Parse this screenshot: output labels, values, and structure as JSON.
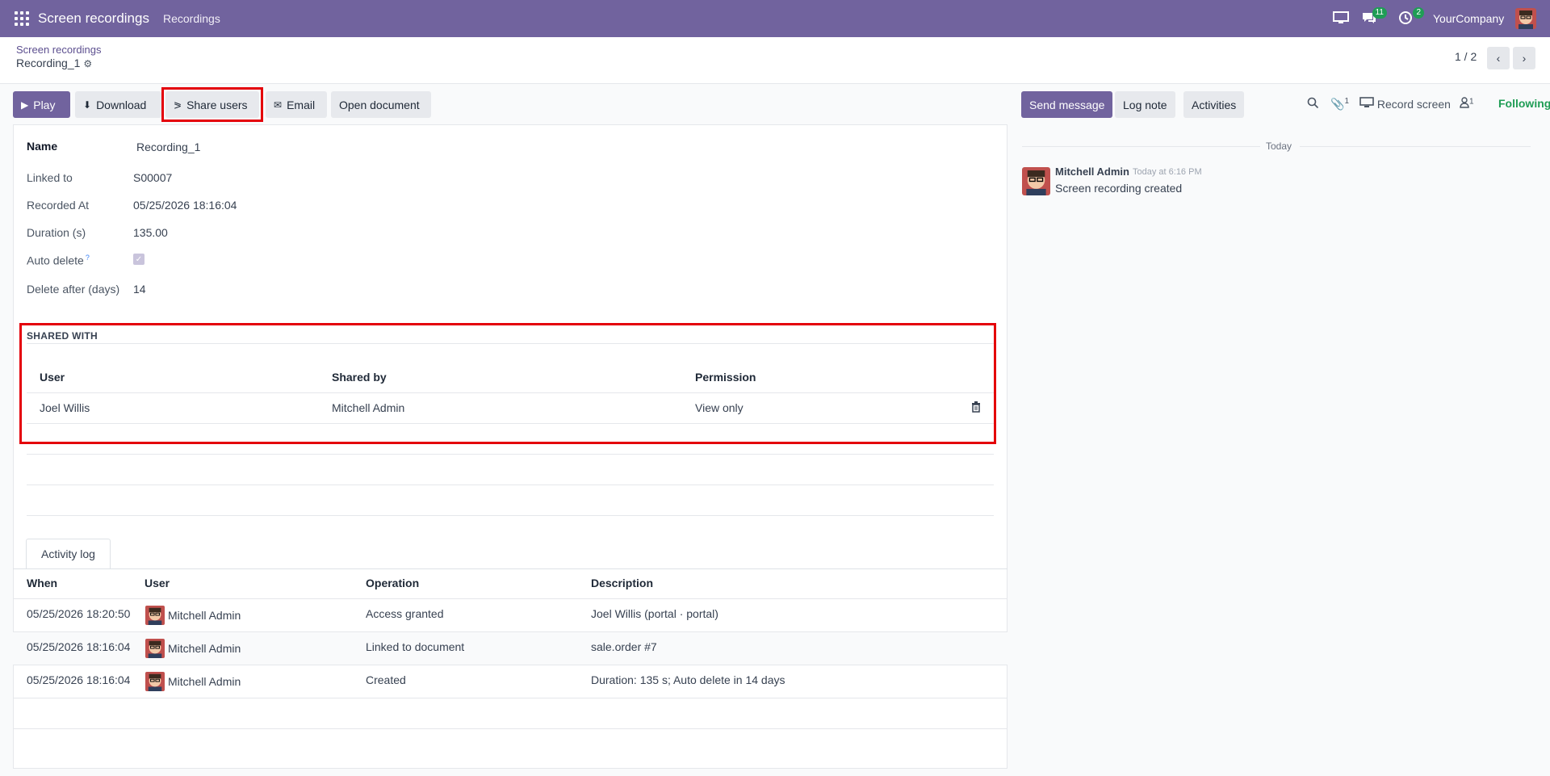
{
  "navbar": {
    "brand": "Screen recordings",
    "menu": "Recordings",
    "messages_badge": "11",
    "activities_badge": "2",
    "company": "YourCompany"
  },
  "breadcrumb": {
    "parent": "Screen recordings",
    "current": "Recording_1"
  },
  "pager": {
    "value": "1 / 2"
  },
  "actions": {
    "play": "Play",
    "download": "Download",
    "share_users": "Share users",
    "email": "Email",
    "open_document": "Open document"
  },
  "form": {
    "name_label": "Name",
    "name_value": "Recording_1",
    "linked_label": "Linked to",
    "linked_value": "S00007",
    "recorded_label": "Recorded At",
    "recorded_value": "05/25/2026 18:16:04",
    "duration_label": "Duration (s)",
    "duration_value": "135.00",
    "autodelete_label": "Auto delete",
    "autodelete_help": "?",
    "delete_after_label": "Delete after (days)",
    "delete_after_value": "14"
  },
  "shared_with": {
    "title": "SHARED WITH",
    "headers": {
      "user": "User",
      "shared_by": "Shared by",
      "permission": "Permission"
    },
    "rows": [
      {
        "user": "Joel Willis",
        "shared_by": "Mitchell Admin",
        "permission": "View only"
      }
    ]
  },
  "activity_log": {
    "tab": "Activity log",
    "headers": {
      "when": "When",
      "user": "User",
      "operation": "Operation",
      "description": "Description"
    },
    "rows": [
      {
        "when": "05/25/2026 18:20:50",
        "user": "Mitchell Admin",
        "operation": "Access granted",
        "description": "Joel Willis (portal · portal)"
      },
      {
        "when": "05/25/2026 18:16:04",
        "user": "Mitchell Admin",
        "operation": "Linked to document",
        "description": "sale.order #7"
      },
      {
        "when": "05/25/2026 18:16:04",
        "user": "Mitchell Admin",
        "operation": "Created",
        "description": "Duration: 135 s; Auto delete in 14 days"
      }
    ]
  },
  "chatter": {
    "send_message": "Send message",
    "log_note": "Log note",
    "activities": "Activities",
    "attachments_count": "1",
    "record_screen": "Record screen",
    "followers_count": "1",
    "following": "Following",
    "today": "Today",
    "message": {
      "author": "Mitchell Admin",
      "time": "Today at 6:16 PM",
      "body": "Screen recording created"
    }
  },
  "colors": {
    "brand": "#71639e",
    "highlight": "#e4000a",
    "success": "#1f9d55"
  }
}
